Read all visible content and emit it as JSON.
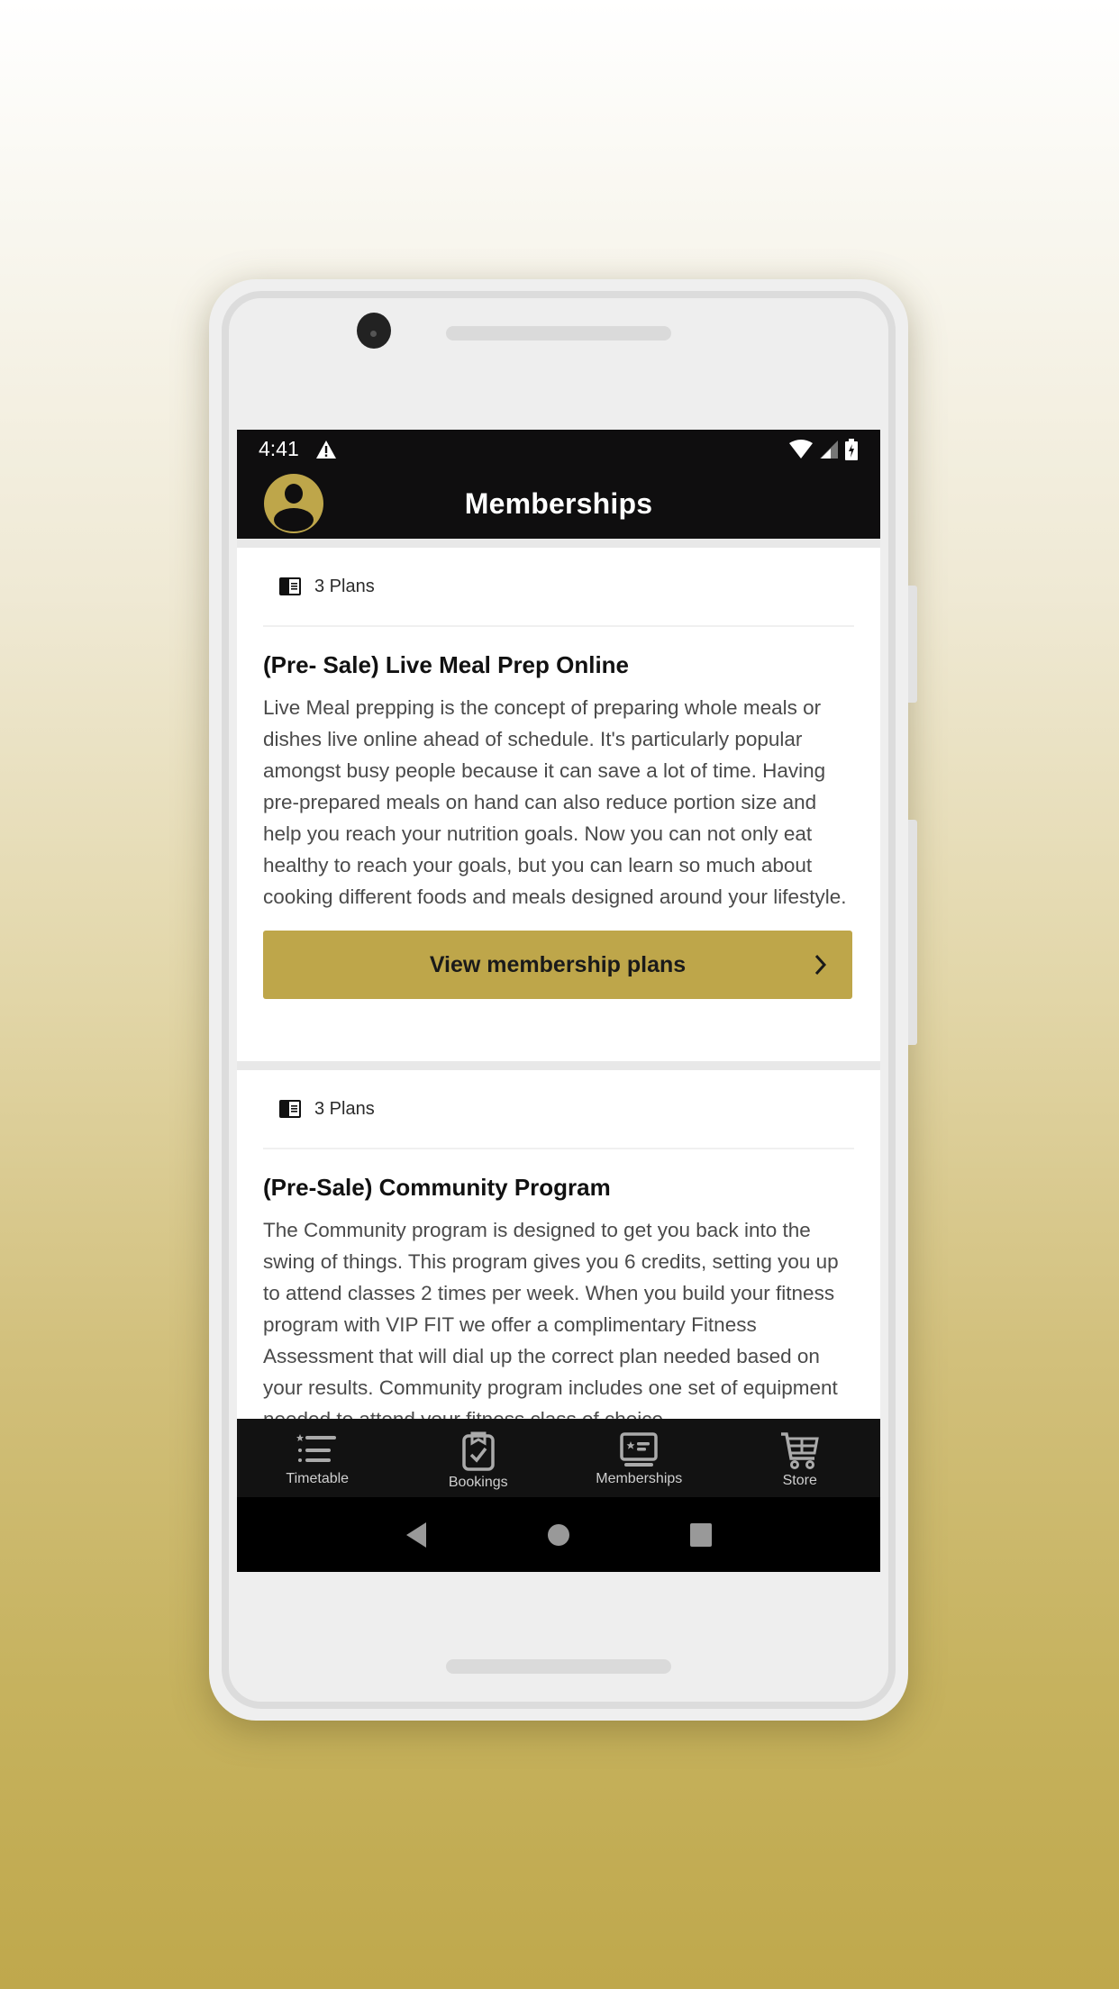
{
  "status_bar": {
    "time": "4:41",
    "icons": [
      "alert-icon",
      "wifi-icon",
      "signal-icon",
      "battery-charging-icon"
    ]
  },
  "app_bar": {
    "title": "Memberships",
    "avatar_icon": "user-avatar-icon"
  },
  "colors": {
    "accent": "#bea64a",
    "app_bar_bg": "#0f0e0f",
    "bottom_nav_bg": "#121212"
  },
  "memberships": [
    {
      "plans_count_label": "3 Plans",
      "title": "(Pre- Sale) Live Meal Prep Online",
      "description": "Live Meal prepping is the concept of preparing whole meals or dishes live online ahead of schedule. It's particularly popular amongst busy people because it can save a lot of time. Having pre-prepared meals on hand can also reduce portion size and help you reach your nutrition goals. Now you can not only eat healthy to reach your goals, but you can learn so much about cooking different foods and meals designed around your lifestyle.",
      "button_label": "View membership plans"
    },
    {
      "plans_count_label": "3 Plans",
      "title": "(Pre-Sale) Community Program",
      "description": "The Community program is designed to get you back into the swing of things. This program gives you 6 credits, setting you up to attend classes 2 times per week. When you build your fitness program with VIP FIT we offer a complimentary Fitness Assessment that will dial up the correct plan needed based on your results.  Community program includes one set of equipment needed to attend your fitness class of choice."
    }
  ],
  "bottom_nav": {
    "items": [
      {
        "label": "Timetable",
        "icon": "timetable-list-icon"
      },
      {
        "label": "Bookings",
        "icon": "clipboard-check-icon"
      },
      {
        "label": "Memberships",
        "icon": "membership-card-icon"
      },
      {
        "label": "Store",
        "icon": "cart-icon"
      }
    ]
  },
  "system_nav": {
    "buttons": [
      "back-icon",
      "home-icon",
      "recents-icon"
    ]
  }
}
